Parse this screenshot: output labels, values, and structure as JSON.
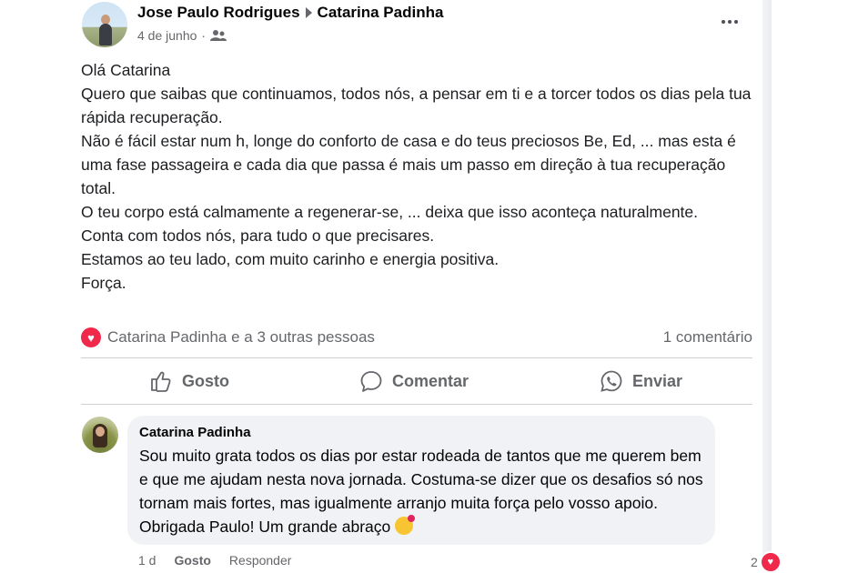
{
  "post": {
    "author": "Jose Paulo Rodrigues",
    "target": "Catarina Padinha",
    "date": "4 de junho",
    "date_separator": "·",
    "audience_icon": "friends-icon",
    "more_icon": "more-options-icon",
    "body": [
      "Olá Catarina",
      "Quero que saibas que continuamos, todos nós, a pensar em ti e a torcer todos os dias pela tua rápida recuperação.",
      "Não é fácil estar num h, longe do conforto de casa e do teus preciosos Be, Ed, ... mas esta é uma fase passageira e cada dia que passa é mais um passo em direção à tua recuperação total.",
      "O teu corpo está calmamente a regenerar-se, ... deixa que isso aconteça naturalmente.",
      "Conta com todos nós, para tudo o que precisares.",
      "Estamos ao teu lado, com muito carinho e energia positiva.",
      "Força."
    ]
  },
  "reactions": {
    "icon": "love-reaction-icon",
    "summary": "Catarina Padinha e a 3 outras pessoas",
    "comments_count": "1 comentário"
  },
  "actions": {
    "like": "Gosto",
    "comment": "Comentar",
    "send": "Enviar"
  },
  "comment": {
    "author": "Catarina Padinha",
    "text": "Sou muito grata todos os dias por estar rodeada de tantos que me querem bem e que me ajudam nesta nova jornada. Costuma-se dizer que os desafios só nos tornam mais fortes, mas igualmente arranjo muita força pelo vosso apoio. Obrigada Paulo! Um grande abraço",
    "emoji": "face-blowing-kiss-emoji",
    "time": "1 d",
    "like_label": "Gosto",
    "reply_label": "Responder",
    "reaction_count": "2"
  },
  "colors": {
    "love": "#f0284a",
    "secondary_text": "#65676b",
    "bubble": "#f0f2f5"
  }
}
